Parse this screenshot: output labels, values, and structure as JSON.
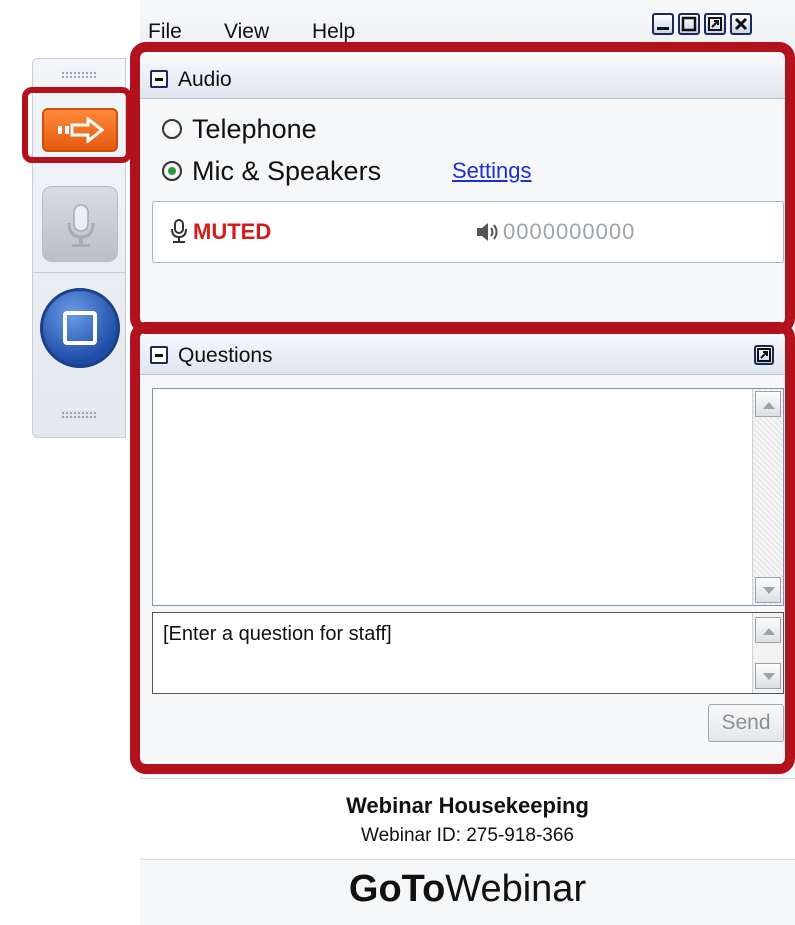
{
  "menu": [
    "File",
    "View",
    "Help"
  ],
  "window_controls": [
    "minimize",
    "maximize",
    "restore",
    "close"
  ],
  "audio": {
    "title": "Audio",
    "options": [
      "Telephone",
      "Mic & Speakers"
    ],
    "selected": "Mic & Speakers",
    "settings_link": "Settings",
    "muted": "MUTED",
    "level": "0000000000"
  },
  "questions": {
    "title": "Questions",
    "placeholder": "[Enter a question for staff]",
    "send": "Send"
  },
  "footer": {
    "title": "Webinar Housekeeping",
    "id": "Webinar ID: 275-918-366"
  },
  "brand": {
    "bold": "GoTo",
    "rest": "Webinar"
  },
  "colors": {
    "highlight": "#b1121c",
    "muted": "#d51b1b",
    "link": "#1c2fd6",
    "accent": "#e55a10"
  },
  "icons": [
    "arrow-right-icon",
    "microphone-icon",
    "screen-icon",
    "speaker-icon"
  ]
}
